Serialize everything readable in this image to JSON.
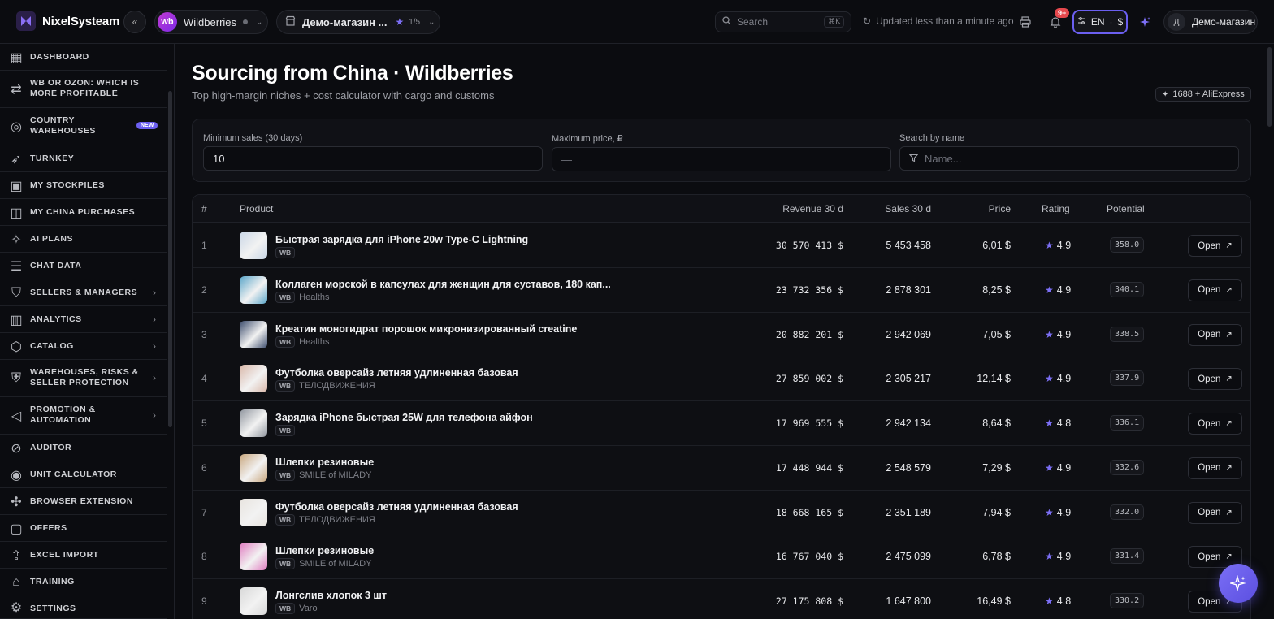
{
  "app": {
    "name": "NixelSysteam"
  },
  "header": {
    "marketplace": "Wildberries",
    "marketplace_logo": "wb",
    "store": "Демо-магазин ...",
    "store_count": "1/5",
    "search_placeholder": "Search",
    "search_shortcut": "⌘K",
    "updated": "Updated less than a minute ago",
    "notifications_badge": "9+",
    "language": "EN",
    "currency": "$",
    "user_initial": "Д",
    "user_name": "Демо-магазин"
  },
  "sidebar": {
    "items": [
      {
        "label": "Dashboard",
        "icon": "dashboard-icon"
      },
      {
        "label": "WB or Ozon: which is more profitable",
        "icon": "compare-icon"
      },
      {
        "label": "Country warehouses",
        "icon": "globe-icon",
        "badge": "NEW"
      },
      {
        "label": "Turnkey",
        "icon": "rocket-icon"
      },
      {
        "label": "My stockpiles",
        "icon": "box-icon"
      },
      {
        "label": "My China purchases",
        "icon": "bag-icon"
      },
      {
        "label": "AI Plans",
        "icon": "sparkle-icon"
      },
      {
        "label": "Chat data",
        "icon": "database-icon"
      },
      {
        "label": "Sellers & Managers",
        "icon": "handshake-icon",
        "expandable": true
      },
      {
        "label": "Analytics",
        "icon": "chart-icon",
        "expandable": true
      },
      {
        "label": "Catalog",
        "icon": "cube-icon",
        "expandable": true
      },
      {
        "label": "Warehouses, risks & seller protection",
        "icon": "shield-icon",
        "expandable": true
      },
      {
        "label": "Promotion & Automation",
        "icon": "megaphone-icon",
        "expandable": true
      },
      {
        "label": "Auditor",
        "icon": "check-circle-icon"
      },
      {
        "label": "Unit calculator",
        "icon": "target-icon"
      },
      {
        "label": "Browser extension",
        "icon": "puzzle-icon"
      },
      {
        "label": "Offers",
        "icon": "message-icon"
      },
      {
        "label": "Excel import",
        "icon": "upload-icon"
      },
      {
        "label": "Training",
        "icon": "graduation-icon"
      },
      {
        "label": "Settings",
        "icon": "gear-icon"
      }
    ]
  },
  "page": {
    "title": "Sourcing from China · Wildberries",
    "subtitle": "Top high-margin niches + cost calculator with cargo and customs",
    "source_badge": "1688 + AliExpress"
  },
  "filters": {
    "min_sales_label": "Minimum sales (30 days)",
    "min_sales_value": "10",
    "max_price_label": "Maximum price, ₽",
    "max_price_placeholder": "—",
    "search_label": "Search by name",
    "search_placeholder": "Name..."
  },
  "table": {
    "columns": {
      "num": "#",
      "product": "Product",
      "revenue": "Revenue 30 d",
      "sales": "Sales 30 d",
      "price": "Price",
      "rating": "Rating",
      "potential": "Potential"
    },
    "open_label": "Open",
    "marketplace_tag": "WB",
    "rows": [
      {
        "num": "1",
        "title": "Быстрая зарядка для iPhone 20w Type-C Lightning",
        "brand": "",
        "revenue": "30 570 413 $",
        "sales": "5 453 458",
        "price": "6,01 $",
        "rating": "4.9",
        "potential": "358.0",
        "thumb": "#c9d6e6"
      },
      {
        "num": "2",
        "title": "Коллаген морской в капсулах для женщин для суставов, 180 кап...",
        "brand": "Healths",
        "revenue": "23 732 356 $",
        "sales": "2 878 301",
        "price": "8,25 $",
        "rating": "4.9",
        "potential": "340.1",
        "thumb": "#5aa6c9"
      },
      {
        "num": "3",
        "title": "Креатин моногидрат порошок микронизированный creatine",
        "brand": "Healths",
        "revenue": "20 882 201 $",
        "sales": "2 942 069",
        "price": "7,05 $",
        "rating": "4.9",
        "potential": "338.5",
        "thumb": "#3a4a6b"
      },
      {
        "num": "4",
        "title": "Футболка оверсайз летняя удлиненная базовая",
        "brand": "ТЕЛОДВИЖЕНИЯ",
        "revenue": "27 859 002 $",
        "sales": "2 305 217",
        "price": "12,14 $",
        "rating": "4.9",
        "potential": "337.9",
        "thumb": "#d9b7a9"
      },
      {
        "num": "5",
        "title": "Зарядка iPhone быстрая 25W для телефона айфон",
        "brand": "",
        "revenue": "17 969 555 $",
        "sales": "2 942 134",
        "price": "8,64 $",
        "rating": "4.8",
        "potential": "336.1",
        "thumb": "#8f959e"
      },
      {
        "num": "6",
        "title": "Шлепки резиновые",
        "brand": "SMILE of MILADY",
        "revenue": "17 448 944 $",
        "sales": "2 548 579",
        "price": "7,29 $",
        "rating": "4.9",
        "potential": "332.6",
        "thumb": "#c9a77e"
      },
      {
        "num": "7",
        "title": "Футболка оверсайз летняя удлиненная базовая",
        "brand": "ТЕЛОДВИЖЕНИЯ",
        "revenue": "18 668 165 $",
        "sales": "2 351 189",
        "price": "7,94 $",
        "rating": "4.9",
        "potential": "332.0",
        "thumb": "#e8e4df"
      },
      {
        "num": "8",
        "title": "Шлепки резиновые",
        "brand": "SMILE of MILADY",
        "revenue": "16 767 040 $",
        "sales": "2 475 099",
        "price": "6,78 $",
        "rating": "4.9",
        "potential": "331.4",
        "thumb": "#e07cc0"
      },
      {
        "num": "9",
        "title": "Лонгслив хлопок 3 шт",
        "brand": "Varo",
        "revenue": "27 175 808 $",
        "sales": "1 647 800",
        "price": "16,49 $",
        "rating": "4.8",
        "potential": "330.2",
        "thumb": "#d8d8d8"
      }
    ]
  },
  "colors": {
    "accent": "#6b5ff0",
    "badge_red": "#e5484d",
    "background": "#0b0c10"
  }
}
